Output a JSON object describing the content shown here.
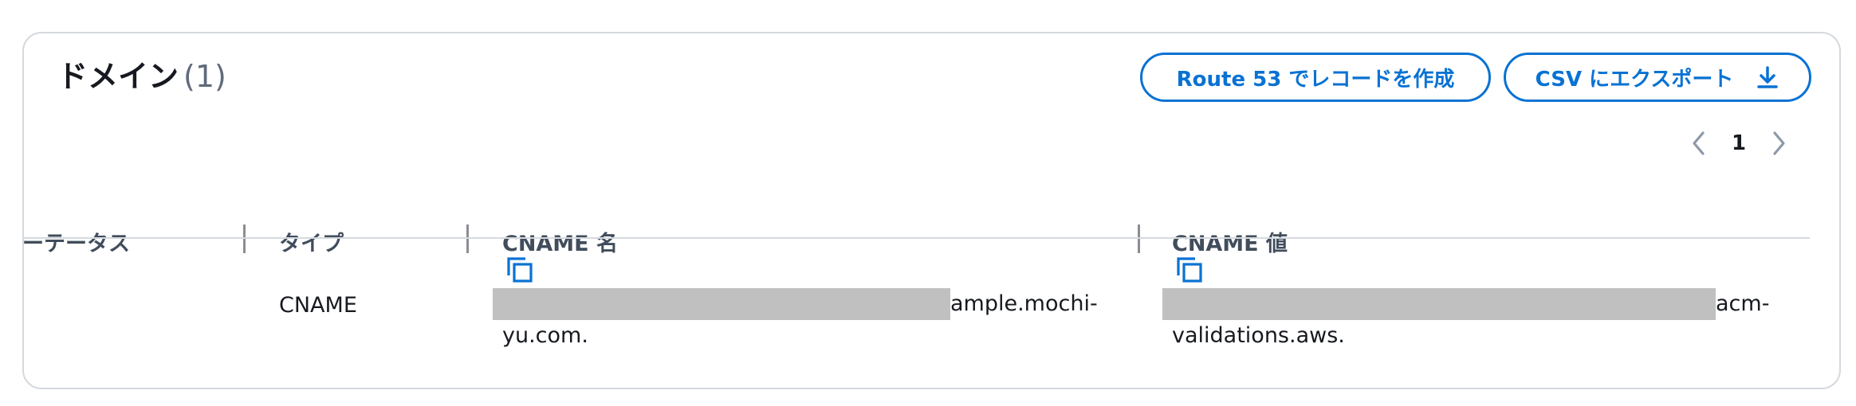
{
  "panel": {
    "title": "ドメイン",
    "count": "(1)"
  },
  "actions": {
    "route53_label": "Route 53 でレコードを作成",
    "csv_export_label": "CSV にエクスポート",
    "csv_icon": "download-icon"
  },
  "pagination": {
    "current_page": "1",
    "prev_icon": "chevron-left-icon",
    "next_icon": "chevron-right-icon"
  },
  "table": {
    "columns": [
      "ーテータス",
      "タイプ",
      "CNAME 名",
      "CNAME 値"
    ],
    "rows": [
      {
        "status": "",
        "type": "CNAME",
        "cname_name_line1": "ample.mochi-",
        "cname_name_line2": "yu.com.",
        "cname_value_line1": "acm-",
        "cname_value_line2": "validations.aws."
      }
    ]
  },
  "colors": {
    "accent": "#0972d3",
    "border": "#d5d9de",
    "redaction": "#c0c0c0"
  }
}
